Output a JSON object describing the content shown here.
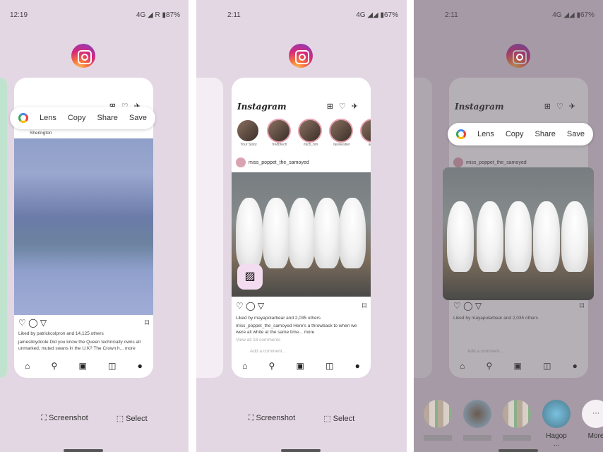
{
  "panels": [
    {
      "status": {
        "time": "12:19",
        "right": "4G ◢ R ▮87%"
      },
      "lens": {
        "items": [
          "Lens",
          "Copy",
          "Share",
          "Save"
        ]
      },
      "post": {
        "user_sub": "Sherington",
        "liked": "Liked by patrickcolpron and 14,125 others",
        "caption": "jameslloydcole Did you know the Queen technically owns all unmarked, muted swans in the U.K? The Crown h... more"
      },
      "buttons": {
        "screenshot": "Screenshot",
        "select": "Select"
      }
    },
    {
      "status": {
        "time": "2:11",
        "right": "4G ◢◢ ▮67%"
      },
      "app": {
        "logo": "Instagram"
      },
      "stories": [
        "Your Story",
        "fredbtech",
        "mich_hm",
        "tarekesber",
        "admo"
      ],
      "post": {
        "user": "miss_poppet_the_samoyed",
        "liked": "Liked by mayapolarbear and 2,035 others",
        "caption": "miss_poppet_the_samoyed Here's a throwback to when we were all white at the same time... more",
        "comments": "View all 18 comments",
        "add_comment": "Add a comment..."
      },
      "buttons": {
        "screenshot": "Screenshot",
        "select": "Select"
      }
    },
    {
      "status": {
        "time": "2:11",
        "right": "4G ◢◢ ▮67%"
      },
      "app": {
        "logo": "Instagram"
      },
      "lens": {
        "items": [
          "Lens",
          "Copy",
          "Share",
          "Save"
        ]
      },
      "post": {
        "user": "miss_poppet_the_samoyed",
        "liked": "Liked by mayapolarbear and 2,035 others",
        "add_comment": "Add a comment..."
      },
      "share_targets": [
        "Hagop ...",
        "More"
      ]
    }
  ],
  "colors": {
    "panel_bg": "#e4d7e4",
    "accent": "#d52a7a"
  }
}
